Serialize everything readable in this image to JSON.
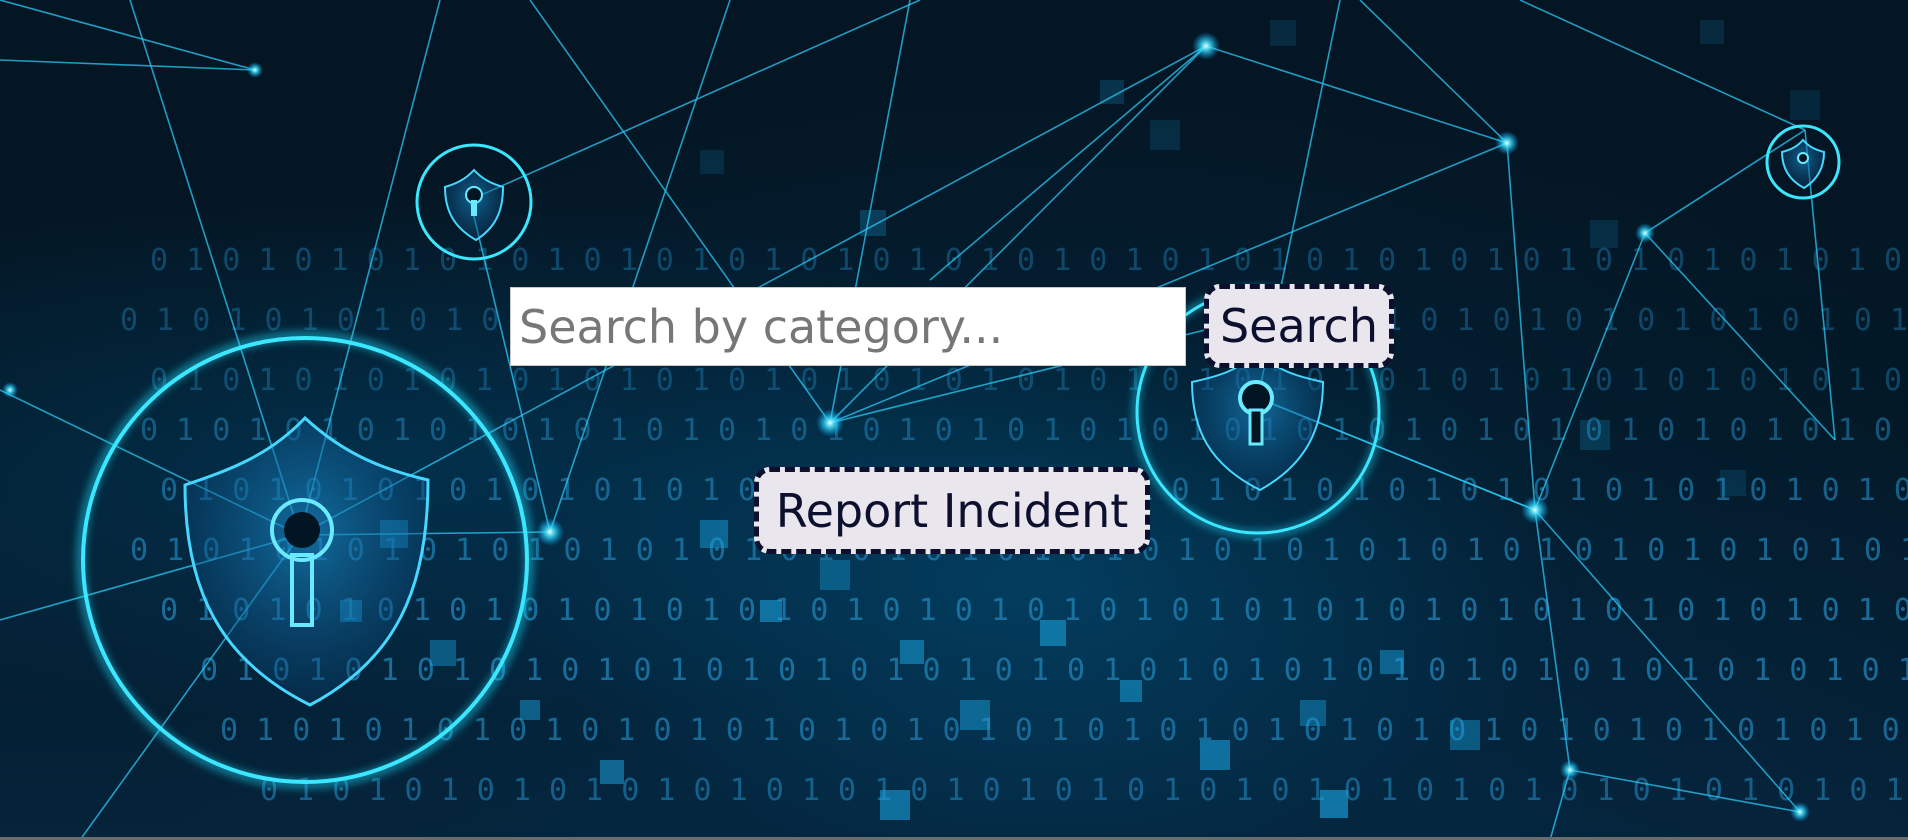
{
  "search": {
    "placeholder": "Search by category...",
    "value": "",
    "button_label": "Search"
  },
  "actions": {
    "report_label": "Report Incident"
  },
  "background": {
    "accent_color": "#00d2ff",
    "base_color": "#031826",
    "binary_text": "0 1 0 1 0 1 0 1 0 1 0 1 0 1 0 1 0 1 0 1 0 1 0 1 0 1 0 1 0 1 0 1 0 1 0 1 0 1 0 1 0 1 0 1 0 1 0 1 0 1 0 1 0 1 0 1 0 1 0 1 0 1 0 1 0 1 0 1 0 1",
    "icons": [
      "shield-lock-icon",
      "network-lines"
    ]
  }
}
